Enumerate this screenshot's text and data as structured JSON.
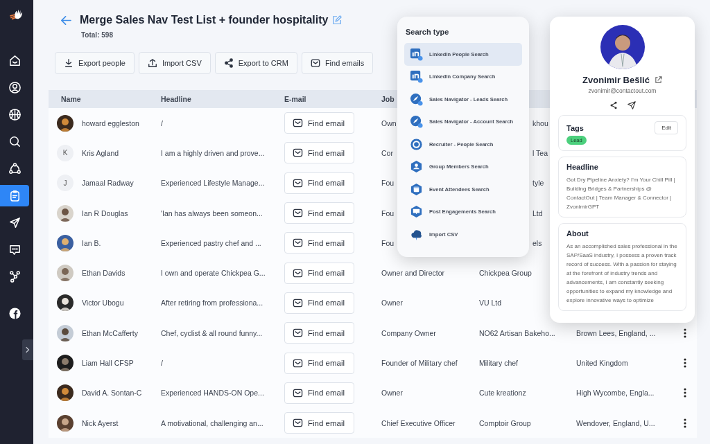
{
  "sidebar": {
    "items": [
      {
        "selected": false
      },
      {
        "selected": false
      },
      {
        "selected": false
      },
      {
        "selected": false
      },
      {
        "selected": false
      },
      {
        "selected": true
      },
      {
        "selected": false
      },
      {
        "selected": false
      },
      {
        "selected": false
      },
      {
        "selected": false
      }
    ]
  },
  "header": {
    "title": "Merge Sales Nav Test List + founder hospitality",
    "total": "Total: 598"
  },
  "toolbar": [
    "Export people",
    "Import CSV",
    "Export to CRM",
    "Find emails"
  ],
  "table": {
    "columns": [
      "Name",
      "Headline",
      "E-mail",
      "Job"
    ],
    "rows": [
      {
        "name": "howard eggleston",
        "headline": "/",
        "email_button": "Find email",
        "job": "Own",
        "company_fragment": "khou"
      },
      {
        "name": "Kris Agland",
        "avatar": {
          "kind": "initial",
          "letter": "K"
        },
        "headline": "I am a highly driven and prove...",
        "email_button": "Find email",
        "job": "Cor",
        "company_fragment": "l Tea"
      },
      {
        "name": "Jamaal Radway",
        "avatar": {
          "kind": "initial",
          "letter": "J"
        },
        "headline": "Experienced Lifestyle Manage...",
        "email_button": "Find email",
        "job": "Fou",
        "company_fragment": "tyle"
      },
      {
        "name": "Ian R Douglas",
        "headline": "'Ian has always been someon...",
        "email_button": "Find email",
        "job": "Fou",
        "company_fragment": "Ltd"
      },
      {
        "name": "Ian B.",
        "headline": "Experienced pastry chef and ...",
        "email_button": "Find email",
        "job": "Fou",
        "company_fragment": "els"
      },
      {
        "name": "Ethan Davids",
        "headline": "I own and operate Chickpea G...",
        "email_button": "Find email",
        "job": "Owner and Director",
        "company": "Chickpea Group"
      },
      {
        "name": "Victor Ubogu",
        "headline": "After retiring from professiona...",
        "email_button": "Find email",
        "job": "Owner",
        "company": "VU Ltd"
      },
      {
        "name": "Ethan McCafferty",
        "headline": "Chef, cyclist & all round funny...",
        "email_button": "Find email",
        "job": "Company Owner",
        "company": "NO62 Artisan Bakeho...",
        "location": "Brown Lees, England, ..."
      },
      {
        "name": "Liam Hall CFSP",
        "headline": "/",
        "email_button": "Find email",
        "job": "Founder of Military chef",
        "company": "Military chef",
        "location": "United Kingdom"
      },
      {
        "name": "David A. Sontan-C",
        "headline": "Experienced HANDS-ON Ope...",
        "email_button": "Find email",
        "job": "Owner",
        "company": "Cute kreationz",
        "location": "High Wycombe, Engla..."
      },
      {
        "name": "Nick Ayerst",
        "headline": "A motivational, challenging an...",
        "email_button": "Find email",
        "job": "Chief Executive Officer",
        "company": "Comptoir Group",
        "location": "Wendover, England, U..."
      }
    ]
  },
  "search_type": {
    "title": "Search type",
    "items": [
      {
        "label": "LinkedIn People Search",
        "selected": true
      },
      {
        "label": "LinkedIn Company Search",
        "selected": false
      },
      {
        "label": "Sales Navigator - Leads Search",
        "selected": false
      },
      {
        "label": "Sales Navigator - Account Search",
        "selected": false
      },
      {
        "label": "Recruiter - People Search",
        "selected": false
      },
      {
        "label": "Group Members Search",
        "selected": false
      },
      {
        "label": "Event Attendees Search",
        "selected": false
      },
      {
        "label": "Post Engagements Search",
        "selected": false
      },
      {
        "label": "Import CSV",
        "selected": false
      }
    ]
  },
  "profile": {
    "name": "Zvonimir Bešlić",
    "email": "zvonimir@contactout.com",
    "tags": {
      "title": "Tags",
      "edit": "Edit",
      "items": [
        {
          "label": "Lead",
          "color": "#4cd07d"
        }
      ]
    },
    "headline": {
      "title": "Headline",
      "text": "Got Dry Pipeline Anxiety? I'm Your Chill Pill | Building Bridges & Partnerships @ ContactOut | Team Manager & Connector | ZvonimirGPT"
    },
    "about": {
      "title": "About",
      "text": "As an accomplished sales professional in the SAP/SaaS industry, I possess a proven track record of success. With a passion for staying at the forefront of industry trends and advancements, I am constantly seeking opportunities to expand my knowledge and explore innovative ways to optimize"
    }
  }
}
